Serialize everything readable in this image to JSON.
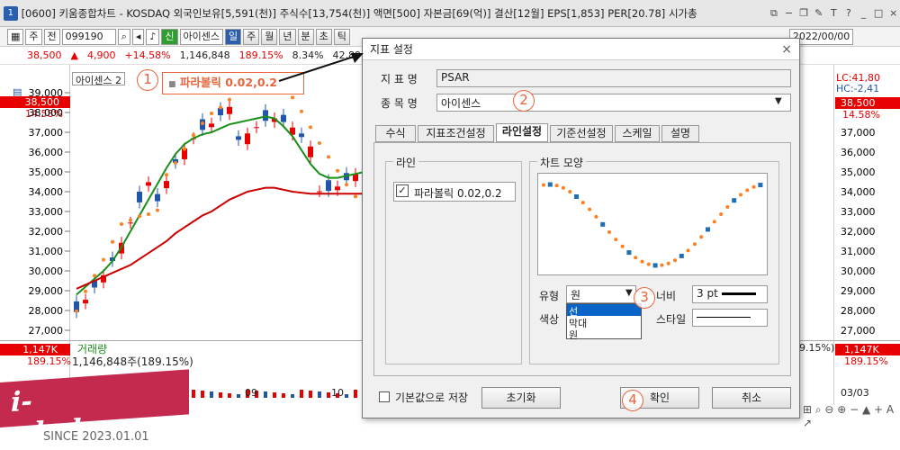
{
  "window": {
    "badge": "1",
    "title": "[0600] 키움종합차트 - KOSDAQ 외국인보유[5,591(천)] 주식수[13,754(천)] 액면[500] 자본금[69(억)] 결산[12월] EPS[1,853] PER[20.78] 시가총"
  },
  "toolbar": {
    "mode": "주",
    "type": "전",
    "code": "099190",
    "stock_badge": "신",
    "stock_name": "아이센스",
    "period_buttons": [
      "일",
      "주",
      "월",
      "년",
      "분",
      "초",
      "틱"
    ],
    "date_value": "2022/00/00"
  },
  "price_bar": {
    "price": "38,500",
    "change": "4,900",
    "rate": "+14.58%",
    "volume": "1,146,848",
    "vol_rate": "189.15%",
    "extra": "8.34%",
    "sum": "42,891"
  },
  "chart": {
    "legend_name": "아이센스",
    "legend_value": "2",
    "psar_legend": "파라볼릭 0.02,0.2",
    "left_ticks": [
      "39,000",
      "38,000",
      "37,000",
      "36,000",
      "35,000",
      "34,000",
      "33,000",
      "32,000",
      "31,000",
      "30,000",
      "29,000",
      "28,000",
      "27,000"
    ],
    "right_ticks": [
      "37,000",
      "36,000",
      "35,000",
      "34,000",
      "33,000",
      "32,000",
      "31,000",
      "30,000",
      "29,000",
      "28,000",
      "27,000"
    ],
    "lc": "LC:41,80",
    "hc": "HC:-2,41",
    "right_price": "38,500",
    "right_rate": "14.58%",
    "current_price": "38,500",
    "current_rate": "14.58%",
    "volume_label": "거래량",
    "volume_text": "1,146,848주(189.15%)",
    "vol_badge": "1,147K",
    "vol_rate_left": "189.15%",
    "vol_badge_r": "1,147K",
    "vol_rate_r": "189.15%",
    "vol_rate_mid": "9.15%)",
    "date_labels": [
      "09",
      "10"
    ],
    "date_right": "03/03"
  },
  "dialog": {
    "title": "지표 설정",
    "close": "×",
    "indicator_label": "지 표 명",
    "indicator_value": "PSAR",
    "stock_label": "종 목 명",
    "stock_value": "아이센스",
    "tabs": [
      "수식",
      "지표조건설정",
      "라인설정",
      "기준선설정",
      "스케일",
      "설명"
    ],
    "active_tab": 2,
    "line_group": "라인",
    "line_item": "파라볼릭 0.02,0.2",
    "chart_group": "차트 모양",
    "type_label": "유형",
    "type_value": "원",
    "type_options": [
      "선",
      "막대",
      "원"
    ],
    "type_selected": 0,
    "width_label": "너비",
    "width_value": "3 pt",
    "color_label": "색상",
    "style_label": "스타일",
    "default_label": "기본값으로 저장",
    "reset": "초기화",
    "ok": "확인",
    "cancel": "취소"
  },
  "annotations": [
    "1",
    "2",
    "3",
    "4"
  ],
  "watermark": {
    "text": "i-whale.com",
    "since": "SINCE 2023.01.01"
  },
  "colors": {
    "up": "#e60000",
    "psar": "#ff7f1f",
    "ma_green": "#1a8f1a",
    "ma_red": "#cc0000",
    "blue": "#2255aa",
    "note": "#e8643c"
  },
  "chart_data": {
    "type": "line",
    "price_range": [
      27000,
      39500
    ],
    "psar_main": [
      28600,
      29600,
      30400,
      31200,
      32100,
      33000,
      33200,
      33400,
      33500,
      33700,
      34400,
      35000,
      35700,
      36400,
      37000,
      37500,
      37800,
      38200,
      38800,
      39100,
      39300,
      39500,
      39300,
      38900,
      38300,
      37600,
      36800,
      36000,
      35300,
      34600,
      33900,
      33300,
      32500,
      31900
    ],
    "ma_green": [
      28800,
      29200,
      29600,
      30000,
      30500,
      31200,
      32000,
      32800,
      33600,
      34400,
      35200,
      35900,
      36400,
      36700,
      36900,
      37000,
      37200,
      37400,
      37500,
      37600,
      37700,
      37800,
      37700,
      37300,
      36800,
      36100,
      35400,
      34900,
      34700,
      34700,
      34800,
      34900,
      35000
    ],
    "ma_red": [
      29100,
      29300,
      29500,
      29700,
      29900,
      30100,
      30300,
      30600,
      30900,
      31200,
      31500,
      31900,
      32200,
      32500,
      32800,
      33000,
      33300,
      33600,
      33800,
      34000,
      34100,
      34200,
      34200,
      34100,
      34000,
      33950,
      33900,
      33900,
      33900,
      33900,
      33900,
      33900,
      33900
    ]
  }
}
